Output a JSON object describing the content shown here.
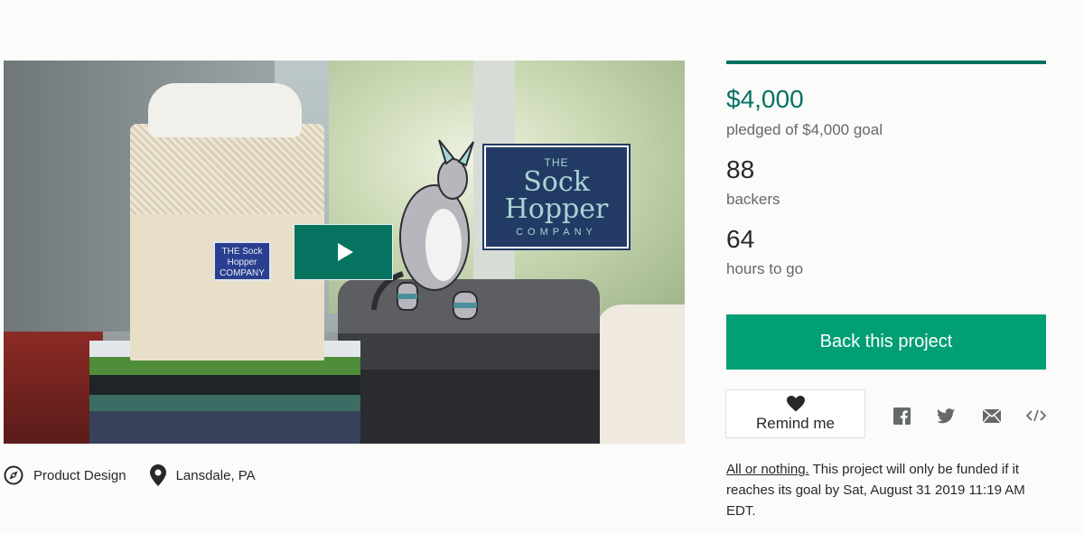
{
  "video": {
    "basket_label": "THE Sock Hopper COMPANY",
    "logo": {
      "the": "THE",
      "line1": "Sock",
      "line2": "Hopper",
      "company": "COMPANY"
    },
    "play_icon": "play-icon"
  },
  "meta": {
    "category_icon": "compass-icon",
    "category": "Product Design",
    "location_icon": "location-pin-icon",
    "location": "Lansdale, PA"
  },
  "stats": {
    "progress_fraction": 1.0,
    "pledged_amount": "$4,000",
    "pledged_label": "pledged of $4,000 goal",
    "backers_count": "88",
    "backers_label": "backers",
    "time_count": "64",
    "time_label": "hours to go"
  },
  "actions": {
    "back_label": "Back this project",
    "remind_label": "Remind me",
    "remind_icon": "heart-icon"
  },
  "share": [
    {
      "icon": "facebook-icon"
    },
    {
      "icon": "twitter-icon"
    },
    {
      "icon": "email-icon"
    },
    {
      "icon": "embed-code-icon"
    }
  ],
  "note": {
    "link": "All or nothing.",
    "text": " This project will only be funded if it reaches its goal by Sat, August 31 2019 11:19 AM EDT."
  },
  "colors": {
    "accent_green": "#029e74",
    "dark_green": "#067361",
    "pledged_green": "#037362"
  }
}
